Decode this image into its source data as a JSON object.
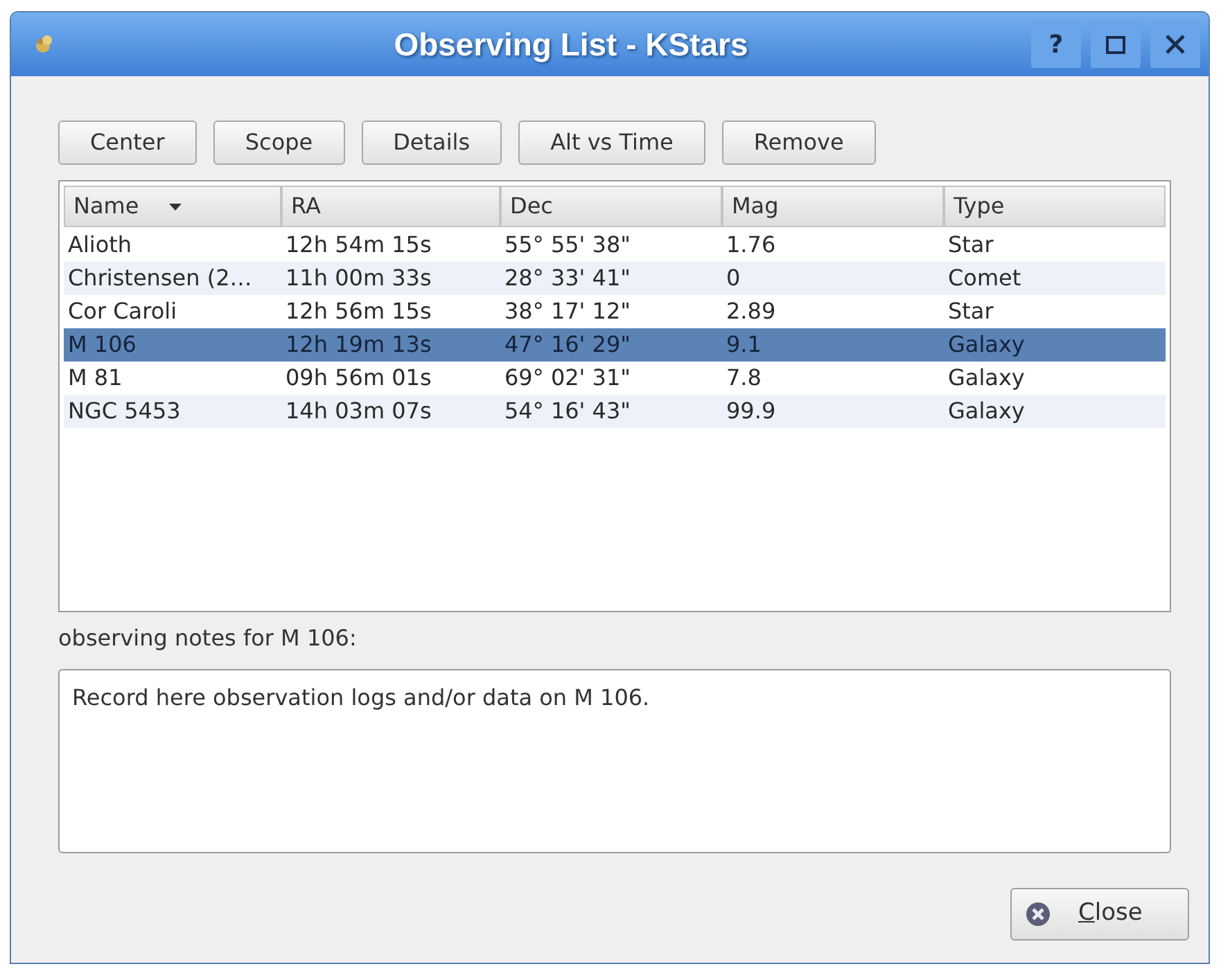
{
  "window": {
    "title": "Observing List - KStars",
    "help_button": "?"
  },
  "toolbar_buttons": [
    "Center",
    "Scope",
    "Details",
    "Alt vs Time",
    "Remove"
  ],
  "table": {
    "columns": [
      {
        "label": "Name",
        "sorted": true
      },
      {
        "label": "RA",
        "sorted": false
      },
      {
        "label": "Dec",
        "sorted": false
      },
      {
        "label": "Mag",
        "sorted": false
      },
      {
        "label": "Type",
        "sorted": false
      }
    ],
    "rows": [
      {
        "cells": [
          "Alioth",
          "12h 54m 15s",
          "55° 55' 38\"",
          "1.76",
          "Star"
        ],
        "selected": false
      },
      {
        "cells": [
          "Christensen (2…",
          "11h 00m 33s",
          "28° 33' 41\"",
          "0",
          "Comet"
        ],
        "selected": false
      },
      {
        "cells": [
          "Cor Caroli",
          "12h 56m 15s",
          "38° 17' 12\"",
          "2.89",
          "Star"
        ],
        "selected": false
      },
      {
        "cells": [
          "M 106",
          "12h 19m 13s",
          "47° 16' 29\"",
          "9.1",
          "Galaxy"
        ],
        "selected": true
      },
      {
        "cells": [
          "M 81",
          "09h 56m 01s",
          "69° 02' 31\"",
          "7.8",
          "Galaxy"
        ],
        "selected": false
      },
      {
        "cells": [
          "NGC 5453",
          "14h 03m 07s",
          "54° 16' 43\"",
          "99.9",
          "Galaxy"
        ],
        "selected": false
      }
    ]
  },
  "notes": {
    "label": "observing notes for M 106:",
    "value": "Record here observation logs and/or data on M 106."
  },
  "close_button": {
    "label": "Close",
    "mnemonic_underlined": true
  }
}
